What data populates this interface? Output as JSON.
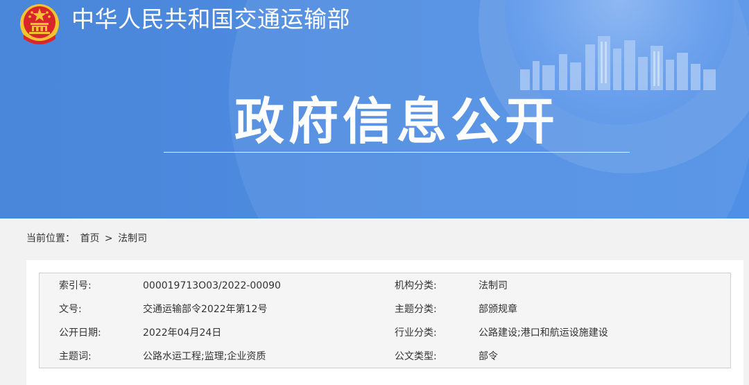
{
  "header": {
    "ministry_name": "中华人民共和国交通运输部",
    "banner_title": "政府信息公开"
  },
  "breadcrumb": {
    "label": "当前位置：",
    "home": "首页",
    "separator": ">",
    "current": "法制司"
  },
  "info": {
    "rows": [
      {
        "key1": "索引号:",
        "value1": "000019713O03/2022-00090",
        "key2": "机构分类:",
        "value2": "法制司"
      },
      {
        "key1": "文号:",
        "value1": "交通运输部令2022年第12号",
        "key2": "主题分类:",
        "value2": "部颁规章"
      },
      {
        "key1": "公开日期:",
        "value1": "2022年04月24日",
        "key2": "行业分类:",
        "value2": "公路建设;港口和航运设施建设"
      },
      {
        "key1": "主题词:",
        "value1": "公路水运工程;监理;企业资质",
        "key2": "公文类型:",
        "value2": "部令"
      }
    ]
  },
  "colors": {
    "banner": "#4d8be0",
    "emblem_red": "#d9262b",
    "emblem_gold": "#f4c430",
    "page_bg": "#f2f2f2"
  }
}
